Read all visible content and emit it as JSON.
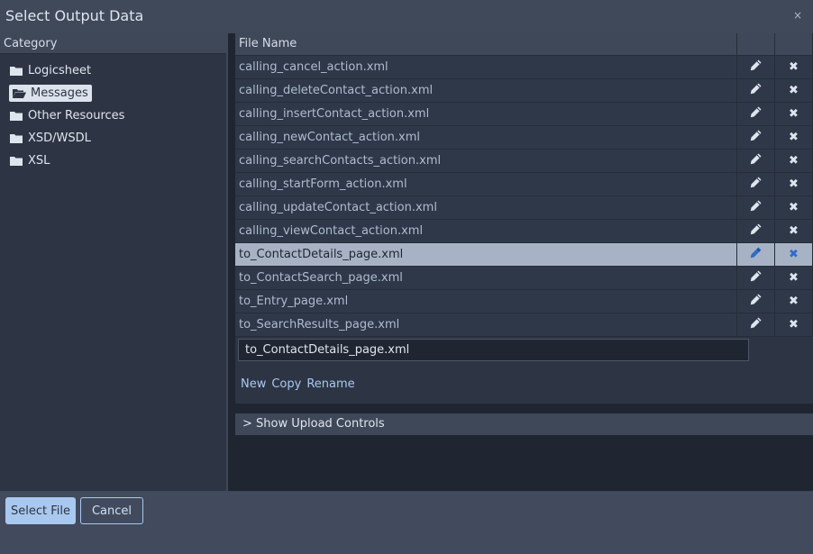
{
  "dialog": {
    "title": "Select Output Data",
    "close_icon": "×"
  },
  "category": {
    "header": "Category",
    "items": [
      {
        "label": "Logicsheet",
        "selected": false
      },
      {
        "label": "Messages",
        "selected": true
      },
      {
        "label": "Other Resources",
        "selected": false
      },
      {
        "label": "XSD/WSDL",
        "selected": false
      },
      {
        "label": "XSL",
        "selected": false
      }
    ]
  },
  "files": {
    "header": "File Name",
    "rows": [
      {
        "name": "calling_cancel_action.xml",
        "selected": false
      },
      {
        "name": "calling_deleteContact_action.xml",
        "selected": false
      },
      {
        "name": "calling_insertContact_action.xml",
        "selected": false
      },
      {
        "name": "calling_newContact_action.xml",
        "selected": false
      },
      {
        "name": "calling_searchContacts_action.xml",
        "selected": false
      },
      {
        "name": "calling_startForm_action.xml",
        "selected": false
      },
      {
        "name": "calling_updateContact_action.xml",
        "selected": false
      },
      {
        "name": "calling_viewContact_action.xml",
        "selected": false
      },
      {
        "name": "to_ContactDetails_page.xml",
        "selected": true
      },
      {
        "name": "to_ContactSearch_page.xml",
        "selected": false
      },
      {
        "name": "to_Entry_page.xml",
        "selected": false
      },
      {
        "name": "to_SearchResults_page.xml",
        "selected": false
      }
    ],
    "filename_value": "to_ContactDetails_page.xml",
    "actions": {
      "new": "New",
      "copy": "Copy",
      "rename": "Rename"
    },
    "upload_toggle": "> Show Upload Controls"
  },
  "footer": {
    "select_label": "Select File",
    "cancel_label": "Cancel"
  },
  "colors": {
    "accent": "#a9c8ef",
    "selected_row": "#a7b3c4",
    "delete_selected": "#2f6cc9"
  },
  "icons": {
    "folder": "folder-icon",
    "folder_open": "folder-open-icon",
    "edit": "pencil-icon",
    "delete": "delete-icon"
  }
}
